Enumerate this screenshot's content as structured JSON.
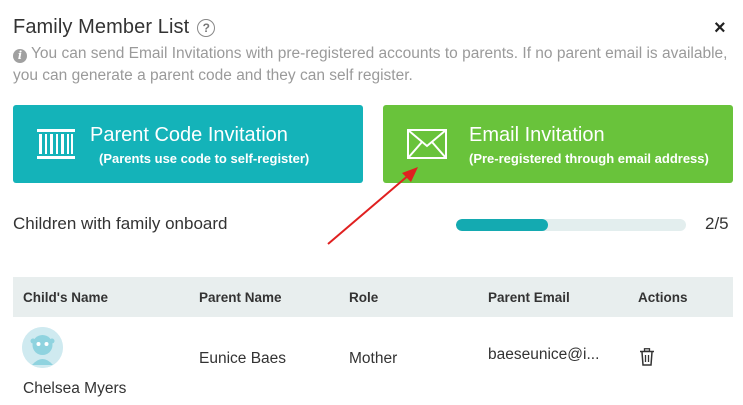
{
  "dialog": {
    "title": "Family Member List",
    "help_icon": "question-circle-icon",
    "close_icon": "close-icon",
    "close_label": "×"
  },
  "info": {
    "icon": "info-icon",
    "icon_glyph": "i",
    "text": "You can send Email Invitations with pre-registered accounts to parents. If no parent email is available, you can generate a parent code and they can self register."
  },
  "cards": {
    "parent_code": {
      "title": "Parent Code Invitation",
      "subtitle": "(Parents use code to self-register)",
      "icon": "barcode-icon",
      "color": "#14b3b9"
    },
    "email": {
      "title": "Email Invitation",
      "subtitle": "(Pre-registered through email address)",
      "icon": "envelope-icon",
      "color": "#69c33b"
    }
  },
  "onboard": {
    "label": "Children with family onboard",
    "count_text": "2/5",
    "progress_fraction": 0.4,
    "color": "#14aab1"
  },
  "annotation": {
    "arrow_color": "#e02020"
  },
  "table": {
    "headers": [
      "Child's Name",
      "Parent Name",
      "Role",
      "Parent Email",
      "Actions"
    ],
    "rows": [
      {
        "child_name": "Chelsea Myers",
        "parent_name": "Eunice Baes",
        "role": "Mother",
        "parent_email": "baeseunice@i...",
        "action_icon": "trash-icon"
      }
    ]
  }
}
